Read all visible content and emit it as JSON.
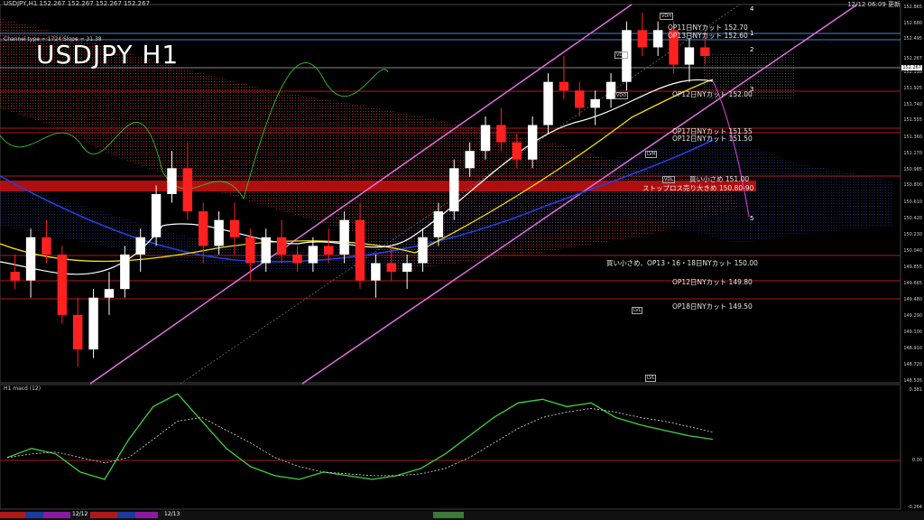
{
  "header": {
    "symbol_line": "USDJPY,H1  152.267 152.267 152.267 152.267",
    "timestamp": "12/12 06:09 更新",
    "indicator_line": "Channel type = 1724 Slope = 31.38",
    "big_title": "USDJPY H1"
  },
  "macd_panel": {
    "title": "H1  macd (12)"
  },
  "price_scale": [
    "152.865",
    "152.680",
    "152.495",
    "152.267",
    "152.110",
    "151.925",
    "151.740",
    "151.555",
    "151.360",
    "151.170",
    "150.985",
    "150.800",
    "150.610",
    "150.420",
    "150.230",
    "150.040",
    "149.855",
    "149.665",
    "149.480",
    "149.290",
    "149.100",
    "148.910",
    "148.720",
    "148.535"
  ],
  "current_price": "152.267",
  "macd_scale": [
    "0.381",
    "0.00",
    "-0.264"
  ],
  "bottom_dates": [
    "12/12",
    "12/13"
  ],
  "levels": [
    {
      "text": "OP11日NYカット 152.70",
      "color": "white"
    },
    {
      "text": "OP13日NYカット 152.60",
      "color": "white"
    },
    {
      "text": "OP12日NYカット 152.00",
      "color": "white"
    },
    {
      "text": "OP17日NYカット 151.55",
      "color": "white"
    },
    {
      "text": "OP12日NYカット 151.50",
      "color": "white"
    },
    {
      "text": "買い小さめ 151.00",
      "color": "white"
    },
    {
      "text": "ストップロス売り大きめ 150.80-90",
      "color": "white"
    },
    {
      "text": "買い小さめ、OP13・16・18日NYカット 150.00",
      "color": "white"
    },
    {
      "text": "OP12日NYカット 149.80",
      "color": "white"
    },
    {
      "text": "OP18日NYカット 149.50",
      "color": "white"
    }
  ],
  "wave_labels": [
    "4",
    "1",
    "2",
    "3",
    "5"
  ],
  "tags": [
    "VDH",
    "VDC",
    "VDO",
    "LVH",
    "VDL",
    "LVL",
    "LVL"
  ],
  "chart_data": {
    "type": "candlestick",
    "title": "USDJPY H1",
    "y_range": [
      148.535,
      152.865
    ],
    "ohlc_approx": [
      [
        149.8,
        150.0,
        149.6,
        149.7
      ],
      [
        149.7,
        150.3,
        149.5,
        150.2
      ],
      [
        150.2,
        150.4,
        149.9,
        150.0
      ],
      [
        150.0,
        150.1,
        149.2,
        149.3
      ],
      [
        149.3,
        149.5,
        148.7,
        148.9
      ],
      [
        148.9,
        149.6,
        148.8,
        149.5
      ],
      [
        149.5,
        149.8,
        149.3,
        149.6
      ],
      [
        149.6,
        150.1,
        149.5,
        150.0
      ],
      [
        150.0,
        150.3,
        149.8,
        150.2
      ],
      [
        150.2,
        150.8,
        150.1,
        150.7
      ],
      [
        150.7,
        151.2,
        150.6,
        151.0
      ],
      [
        151.0,
        151.3,
        150.4,
        150.5
      ],
      [
        150.5,
        150.6,
        149.9,
        150.1
      ],
      [
        150.1,
        150.5,
        150.0,
        150.4
      ],
      [
        150.4,
        150.6,
        150.0,
        150.2
      ],
      [
        150.2,
        150.3,
        149.7,
        149.9
      ],
      [
        149.9,
        150.3,
        149.8,
        150.2
      ],
      [
        150.2,
        150.4,
        149.9,
        150.0
      ],
      [
        150.0,
        150.1,
        149.8,
        149.9
      ],
      [
        149.9,
        150.2,
        149.8,
        150.1
      ],
      [
        150.1,
        150.3,
        149.9,
        150.0
      ],
      [
        150.0,
        150.5,
        149.9,
        150.4
      ],
      [
        150.4,
        150.6,
        149.6,
        149.7
      ],
      [
        149.7,
        150.0,
        149.5,
        149.9
      ],
      [
        149.9,
        150.1,
        149.7,
        149.8
      ],
      [
        149.8,
        150.0,
        149.6,
        149.9
      ],
      [
        149.9,
        150.3,
        149.8,
        150.2
      ],
      [
        150.2,
        150.6,
        150.1,
        150.5
      ],
      [
        150.5,
        151.1,
        150.4,
        151.0
      ],
      [
        151.0,
        151.3,
        150.9,
        151.2
      ],
      [
        151.2,
        151.6,
        151.1,
        151.5
      ],
      [
        151.5,
        151.7,
        151.2,
        151.3
      ],
      [
        151.3,
        151.4,
        151.0,
        151.1
      ],
      [
        151.1,
        151.6,
        151.0,
        151.5
      ],
      [
        151.5,
        152.1,
        151.4,
        152.0
      ],
      [
        152.0,
        152.3,
        151.8,
        151.9
      ],
      [
        151.9,
        152.0,
        151.6,
        151.7
      ],
      [
        151.7,
        151.9,
        151.5,
        151.8
      ],
      [
        151.8,
        152.1,
        151.7,
        152.0
      ],
      [
        152.0,
        152.7,
        151.9,
        152.6
      ],
      [
        152.6,
        152.8,
        152.3,
        152.4
      ],
      [
        152.4,
        152.7,
        152.3,
        152.6
      ],
      [
        152.6,
        152.7,
        152.1,
        152.2
      ],
      [
        152.2,
        152.5,
        152.0,
        152.4
      ],
      [
        152.4,
        152.6,
        152.2,
        152.3
      ]
    ],
    "macd_approx": [
      0.0,
      0.05,
      0.02,
      -0.08,
      -0.12,
      0.1,
      0.28,
      0.35,
      0.2,
      0.05,
      -0.05,
      -0.1,
      -0.12,
      -0.08,
      -0.1,
      -0.12,
      -0.1,
      -0.06,
      0.02,
      0.12,
      0.22,
      0.3,
      0.32,
      0.28,
      0.3,
      0.22,
      0.18,
      0.15,
      0.12,
      0.1
    ],
    "macd_signal_approx": [
      0.0,
      0.02,
      0.03,
      0.0,
      -0.03,
      0.0,
      0.1,
      0.2,
      0.22,
      0.15,
      0.08,
      0.0,
      -0.05,
      -0.08,
      -0.09,
      -0.1,
      -0.1,
      -0.09,
      -0.06,
      0.0,
      0.08,
      0.16,
      0.22,
      0.25,
      0.27,
      0.25,
      0.22,
      0.2,
      0.17,
      0.14
    ]
  }
}
